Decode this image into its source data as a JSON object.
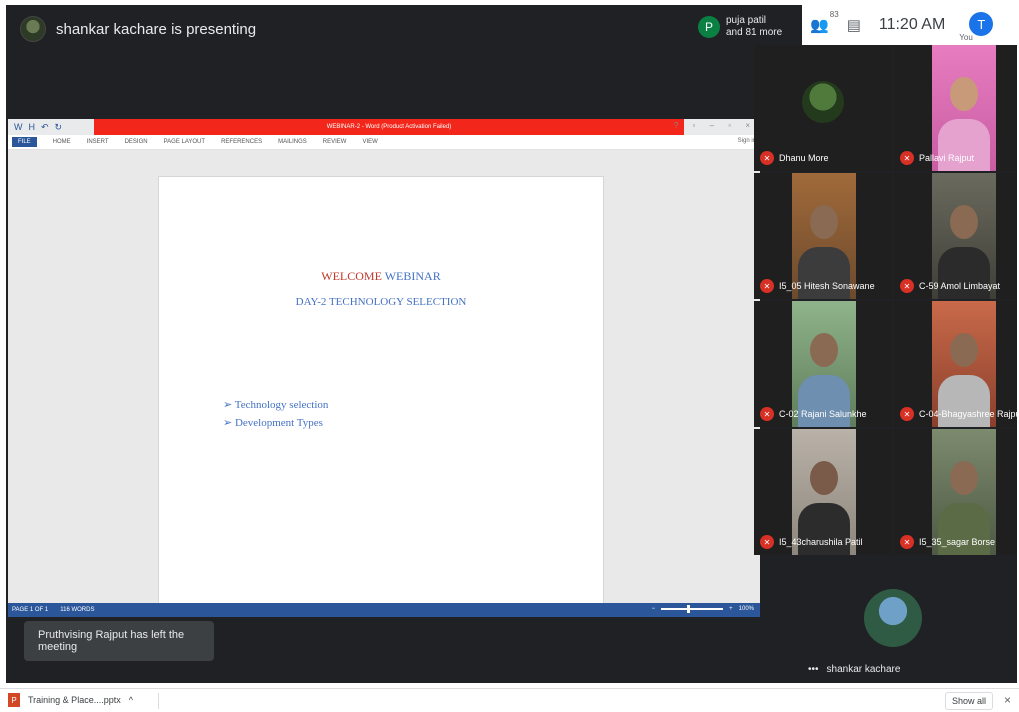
{
  "meet": {
    "presenter_text": "shankar kacharе is presenting",
    "participants_pill": {
      "initial": "P",
      "line1": "puja patil",
      "line2": "and 81 more"
    },
    "toolbar": {
      "participant_count": "83",
      "clock": "11:20 AM",
      "self_initial": "T",
      "self_label": "You"
    },
    "toast": "Pruthvising Rajput has left the meeting"
  },
  "word": {
    "title": "WEBINAR-2 - Word (Product Activation Failed)",
    "qat": [
      "W",
      "H",
      "↶",
      "↻"
    ],
    "winbtns": "? ▫ – ▫ ×",
    "tabs": [
      "FILE",
      "HOME",
      "INSERT",
      "DESIGN",
      "PAGE LAYOUT",
      "REFERENCES",
      "MAILINGS",
      "REVIEW",
      "VIEW"
    ],
    "sign_in": "Sign in",
    "doc": {
      "title_part1": "WELCOME",
      "title_part2": "WEBINAR",
      "subtitle": "DAY-2 TECHNOLOGY SELECTION",
      "bullets": [
        "Technology selection",
        "Development Types"
      ]
    },
    "status": {
      "page": "PAGE 1 OF 1",
      "words": "116 WORDS",
      "zoom": "100%"
    }
  },
  "tiles": [
    {
      "name": "Dhanu More",
      "kind": "avatar"
    },
    {
      "name": "Pallavi Rajput",
      "kind": "photo"
    },
    {
      "name": "I5_05 Hitesh Sonawane",
      "kind": "photo"
    },
    {
      "name": "C-59 Amol Limbayat",
      "kind": "photo"
    },
    {
      "name": "C-02 Rajani Salunkhe",
      "kind": "photo"
    },
    {
      "name": "C-04-Bhagyashree Rajput",
      "kind": "photo"
    },
    {
      "name": "I5_43charushila Patil",
      "kind": "photo"
    },
    {
      "name": "I5_35_sagar Borse",
      "kind": "photo"
    }
  ],
  "self_tile": {
    "name": "shankar kachare",
    "dots": "•••"
  },
  "downloads": {
    "file": "Training & Place....pptx",
    "chevron": "^",
    "show_all": "Show all",
    "close": "×"
  }
}
